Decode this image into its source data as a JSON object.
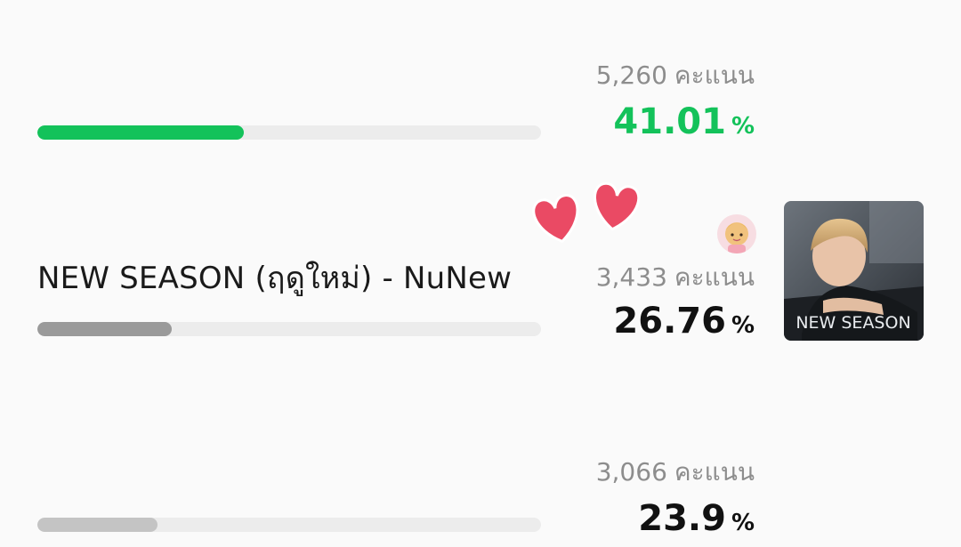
{
  "colors": {
    "leader_bar": "#13c25a",
    "leader_pct": "#13c25a",
    "bar_gray": "#9a9a9a",
    "bar_light_gray": "#c4c4c4",
    "track": "#ececec",
    "score_text": "#8d8d8d",
    "pct_text": "#111111",
    "heart": "#ea4a64"
  },
  "entries": [
    {
      "score": "5,260",
      "score_unit": "คะแนน",
      "percent": "41.01",
      "percent_sign": "%",
      "share": 0.4101
    },
    {
      "title": "NEW SEASON (ฤดูใหม่) - NuNew",
      "score": "3,433",
      "score_unit": "คะแนน",
      "percent": "26.76",
      "percent_sign": "%",
      "share": 0.2676,
      "cover_text": "NEW SEASON",
      "cover_icon": "album-cover-image",
      "avatar_icon": "character-sticker-avatar",
      "decoration_icon": "two-hearts-sticker"
    },
    {
      "score": "3,066",
      "score_unit": "คะแนน",
      "percent": "23.9",
      "percent_sign": "%",
      "share": 0.239
    }
  ]
}
